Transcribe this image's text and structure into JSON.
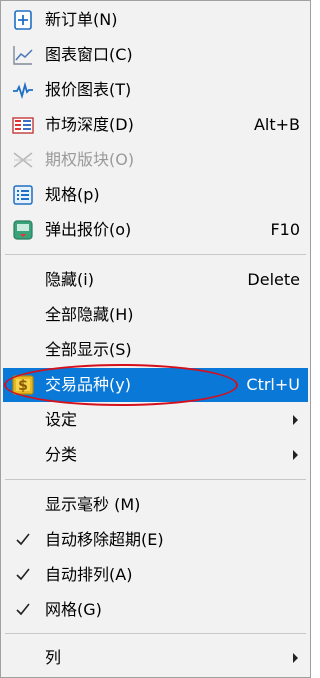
{
  "menu": {
    "group1": [
      {
        "label": "新订单(N)",
        "shortcut": "",
        "icon": "new-order-icon",
        "enabled": true
      },
      {
        "label": "图表窗口(C)",
        "shortcut": "",
        "icon": "chart-window-icon",
        "enabled": true
      },
      {
        "label": "报价图表(T)",
        "shortcut": "",
        "icon": "tick-chart-icon",
        "enabled": true
      },
      {
        "label": "市场深度(D)",
        "shortcut": "Alt+B",
        "icon": "market-depth-icon",
        "enabled": true
      },
      {
        "label": "期权版块(O)",
        "shortcut": "",
        "icon": "options-board-icon",
        "enabled": false
      },
      {
        "label": "规格(p)",
        "shortcut": "",
        "icon": "specification-icon",
        "enabled": true
      },
      {
        "label": "弹出报价(o)",
        "shortcut": "F10",
        "icon": "popup-prices-icon",
        "enabled": true
      }
    ],
    "group2": [
      {
        "label": "隐藏(i)",
        "shortcut": "Delete"
      },
      {
        "label": "全部隐藏(H)",
        "shortcut": ""
      },
      {
        "label": "全部显示(S)",
        "shortcut": ""
      },
      {
        "label": "交易品种(y)",
        "shortcut": "Ctrl+U",
        "icon": "symbols-dollar-icon",
        "selected": true
      },
      {
        "label": "设定",
        "shortcut": "",
        "submenu": true
      },
      {
        "label": "分类",
        "shortcut": "",
        "submenu": true
      }
    ],
    "group3": [
      {
        "label": "显示毫秒 (M)",
        "checked": false
      },
      {
        "label": "自动移除超期(E)",
        "checked": true
      },
      {
        "label": "自动排列(A)",
        "checked": true
      },
      {
        "label": "网格(G)",
        "checked": true
      }
    ],
    "group4": [
      {
        "label": "列",
        "submenu": true
      }
    ],
    "colors": {
      "menu_background": "#f2f2f2",
      "selection": "#0a78d7",
      "highlight_ellipse": "#d4101d",
      "disabled_text": "#9a9a9a"
    }
  }
}
